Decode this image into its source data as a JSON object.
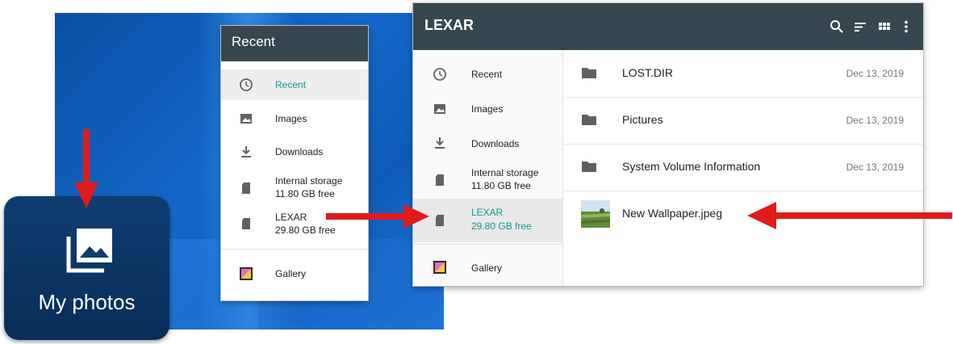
{
  "tile": {
    "label": "My photos",
    "icon": "photo-library-icon"
  },
  "small_window": {
    "title": "Recent",
    "items": [
      {
        "label": "Recent",
        "icon": "clock-icon",
        "selected": true
      },
      {
        "label": "Images",
        "icon": "image-icon"
      },
      {
        "label": "Downloads",
        "icon": "download-icon"
      },
      {
        "label": "Internal storage",
        "sub": "11.80 GB free",
        "icon": "sd-card-icon"
      },
      {
        "label": "LEXAR",
        "sub": "29.80 GB free",
        "icon": "sd-card-icon"
      },
      {
        "label": "Gallery",
        "icon": "gallery-icon"
      }
    ]
  },
  "big_window": {
    "title": "LEXAR",
    "toolbar": [
      "search-icon",
      "sort-icon",
      "grid-view-icon",
      "more-vert-icon"
    ],
    "sidebar": [
      {
        "label": "Recent",
        "icon": "clock-icon"
      },
      {
        "label": "Images",
        "icon": "image-icon"
      },
      {
        "label": "Downloads",
        "icon": "download-icon"
      },
      {
        "label": "Internal storage",
        "sub": "11.80 GB free",
        "icon": "sd-card-icon"
      },
      {
        "label": "LEXAR",
        "sub": "29.80 GB free",
        "icon": "sd-card-icon",
        "selected": true
      },
      {
        "label": "Gallery",
        "icon": "gallery-icon"
      }
    ],
    "files": [
      {
        "name": "LOST.DIR",
        "date": "Dec 13, 2019",
        "type": "folder"
      },
      {
        "name": "Pictures",
        "date": "Dec 13, 2019",
        "type": "folder"
      },
      {
        "name": "System Volume Information",
        "date": "Dec 13, 2019",
        "type": "folder"
      },
      {
        "name": "New Wallpaper.jpeg",
        "date": "",
        "type": "image"
      }
    ]
  },
  "colors": {
    "header": "#37474f",
    "accent": "#159a8c",
    "arrow": "#e01b1b",
    "tile": "#0f3d72"
  }
}
